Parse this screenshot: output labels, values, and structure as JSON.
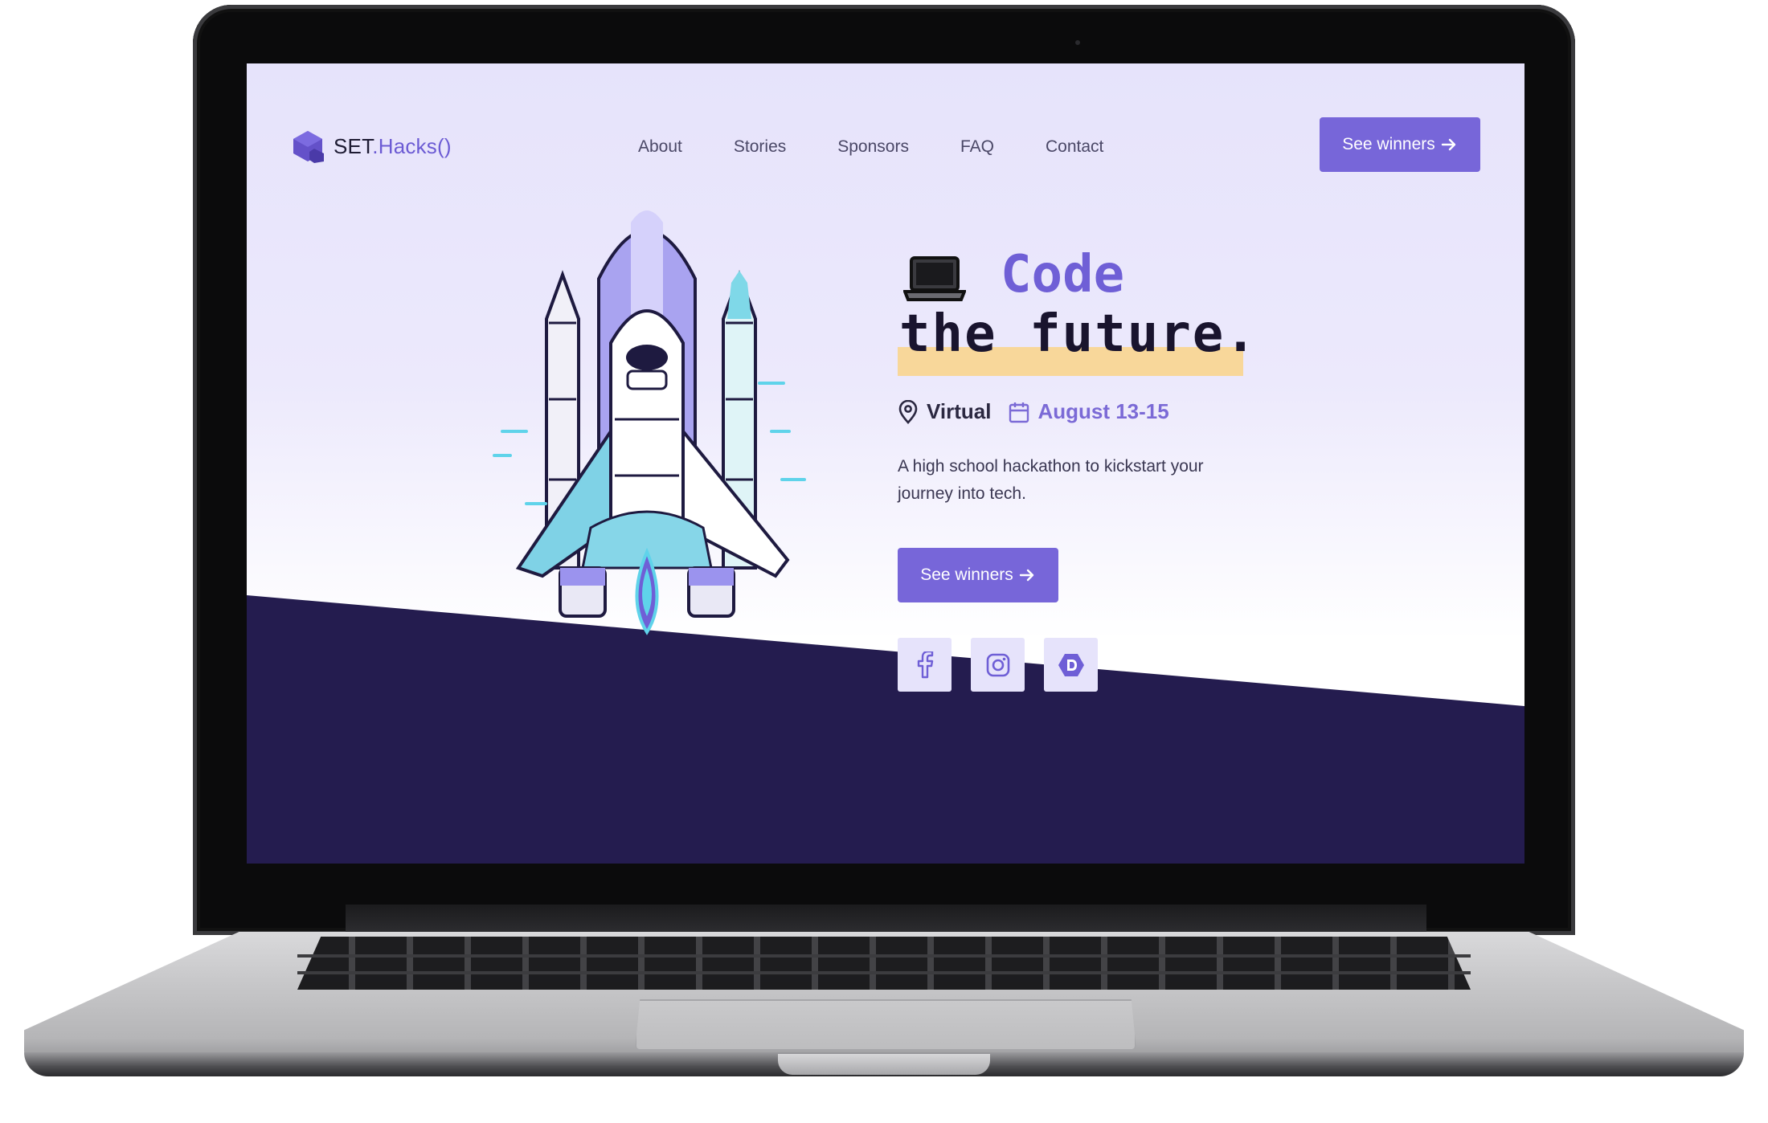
{
  "site": {
    "logo": {
      "brand_main": "SET",
      "brand_accent": ".Hacks()"
    },
    "nav": {
      "items": [
        "About",
        "Stories",
        "Sponsors",
        "FAQ",
        "Contact"
      ]
    },
    "header_cta": "See winners",
    "hero": {
      "emoji": "💻",
      "headline_line1": "Code",
      "headline_line2": "the future.",
      "location": "Virtual",
      "date": "August 13-15",
      "description": "A high school hackathon to kickstart your journey into tech.",
      "cta": "See winners",
      "socials": [
        "facebook-icon",
        "instagram-icon",
        "devpost-icon"
      ]
    },
    "colors": {
      "accent": "#7766d9",
      "headline_dark": "#19142e",
      "highlight": "#f8d79a",
      "background_light": "#e6e3fb",
      "dark_band": "#241c4f"
    }
  }
}
